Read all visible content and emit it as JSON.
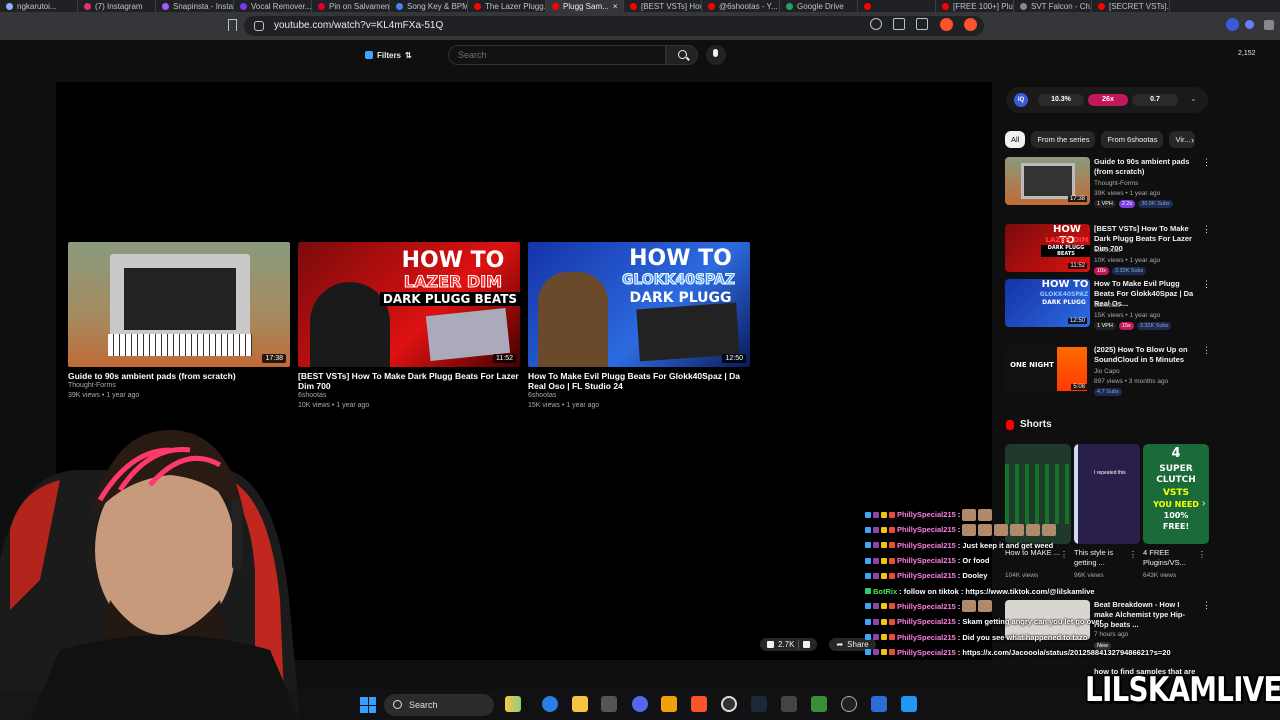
{
  "browser": {
    "tabs": [
      {
        "label": "ngkarutoi...",
        "color": "#8ab4f8"
      },
      {
        "label": "(7) Instagram",
        "color": "#e1306c"
      },
      {
        "label": "Snapinsta - Insta...",
        "color": "#a259ff"
      },
      {
        "label": "Vocal Remover...",
        "color": "#7c3aed"
      },
      {
        "label": "Pin on Salvamen...",
        "color": "#e60023"
      },
      {
        "label": "Song Key & BPM",
        "color": "#4285f4"
      },
      {
        "label": "The Lazer Plugg...",
        "color": "#ff0000"
      },
      {
        "label": "Plugg Sam...",
        "color": "#ff0000",
        "active": true
      },
      {
        "label": "[BEST VSTs] How...",
        "color": "#ff0000"
      },
      {
        "label": "@6shootas - Y...",
        "color": "#ff0000"
      },
      {
        "label": "Google Drive",
        "color": "#1fa463"
      },
      {
        "label": "",
        "color": "#ff0000"
      },
      {
        "label": "[FREE 100+] Plu...",
        "color": "#ff0000"
      },
      {
        "label": "SVT Falcon - Ch...",
        "color": "#888"
      },
      {
        "label": "[SECRET VSTs]...",
        "color": "#ff0000"
      }
    ],
    "url": "youtube.com/watch?v=KL4mFXa-51Q",
    "counter": "2,152"
  },
  "youtube": {
    "filters_label": "Filters",
    "search_placeholder": "Search",
    "endcards": [
      {
        "title": "Guide to 90s ambient pads (from scratch)",
        "channel": "Thought-Forms",
        "meta": "39K views • 1 year ago",
        "duration": "17:38"
      },
      {
        "title": "[BEST VSTs] How To Make Dark Plugg Beats For Lazer Dim 700",
        "channel": "6shootas",
        "meta": "10K views • 1 year ago",
        "duration": "11:52",
        "thumb_lines": [
          "HOW TO",
          "LAZER DIM",
          "DARK PLUGG BEATS"
        ]
      },
      {
        "title": "How To Make Evil Plugg Beats For Glokk40Spaz | Da Real Oso | FL Studio 24",
        "channel": "6shootas",
        "meta": "15K views • 1 year ago",
        "duration": "12:50",
        "thumb_lines": [
          "HOW TO",
          "GLOKK40SPAZ",
          "DARK PLUGG"
        ]
      }
    ],
    "like_count": "2.7K",
    "share_label": "Share",
    "ext_stats": {
      "logo": "iQ",
      "a": "10.3%",
      "b": "26x",
      "c": "0.7"
    },
    "chips": [
      "All",
      "From the series",
      "From 6shootas",
      "Vir..."
    ],
    "recs": [
      {
        "title": "Guide to 90s ambient pads (from scratch)",
        "channel": "Thought-Forms",
        "meta": "39K views • 1 year ago",
        "badges": [
          "1 VPH",
          "2.2x",
          "30.5K Subs"
        ],
        "duration": "17:38"
      },
      {
        "title": "[BEST VSTs] How To Make Dark Plugg Beats For Lazer Dim 700",
        "channel": "6shootas",
        "meta": "10K views • 1 year ago",
        "badges": [
          "10x",
          "3.32K Subs"
        ],
        "duration": "11:52",
        "thumb_lines": [
          "HOW TO",
          "LAZER DIM",
          "DARK PLUGG BEATS"
        ]
      },
      {
        "title": "How To Make Evil Plugg Beats For Glokk40Spaz | Da Real Os...",
        "channel": "6shootas",
        "meta": "15K views • 1 year ago",
        "badges": [
          "1 VPH",
          "15x",
          "3.32K Subs"
        ],
        "duration": "12:50",
        "thumb_lines": [
          "HOW TO",
          "GLOKK40SPAZ",
          "DARK PLUGG"
        ]
      },
      {
        "title": "(2025) How To Blow Up on SoundCloud in 5 Minutes",
        "channel": "Jio Capo",
        "meta": "897 views • 3 months ago",
        "badges": [
          "4.7 Subs"
        ],
        "duration": "5:08",
        "thumb_lines": [
          "ONE NIGHT"
        ]
      },
      {
        "title": "Beat Breakdown - How I make Alchemist type Hip-Hop beats ...",
        "channel": "",
        "meta": "7 hours ago",
        "badges": [
          "New"
        ],
        "duration": ""
      }
    ],
    "shorts_header": "Shorts",
    "shorts": [
      {
        "title": "How to MAKE ...",
        "views": "104K views"
      },
      {
        "title": "This style is getting ...",
        "views": "96K views",
        "overlay": "I repeated this"
      },
      {
        "title": "4 FREE Plugins/VS...",
        "views": "643K views",
        "overlay_lines": [
          "4",
          "SUPER",
          "CLUTCH",
          "VSTS",
          "YOU NEED",
          "100%",
          "FREE!"
        ]
      }
    ],
    "more_partial": "how to find samples that are"
  },
  "chat": [
    {
      "user": "PhillySpecial215",
      "text": ":",
      "emotes": 2
    },
    {
      "user": "PhillySpecial215",
      "text": ":",
      "emotes": 6
    },
    {
      "user": "PhillySpecial215",
      "text": ": Just keep it and get weed",
      "emotes": 0
    },
    {
      "user": "PhillySpecial215",
      "text": ": Or food",
      "emotes": 0
    },
    {
      "user": "PhillySpecial215",
      "text": ": Dooley",
      "emotes": 0
    },
    {
      "user": "BotRix",
      "text": ": follow on tiktok : https://www.tiktok.com/@lilskamlive",
      "emotes": 0,
      "bot": true
    },
    {
      "user": "PhillySpecial215",
      "text": ":",
      "emotes": 2
    },
    {
      "user": "PhillySpecial215",
      "text": ": Skam getting angry can you let go over",
      "emotes": 0
    },
    {
      "user": "PhillySpecial215",
      "text": ": Did you see what happened to tazo",
      "emotes": 0
    },
    {
      "user": "PhillySpecial215",
      "text": ": https://x.com/Jacooola/status/2012588413279486621?s=20",
      "emotes": 0
    }
  ],
  "taskbar": {
    "search_label": "Search"
  },
  "overlay_brand": "LILSKAMLIVE"
}
